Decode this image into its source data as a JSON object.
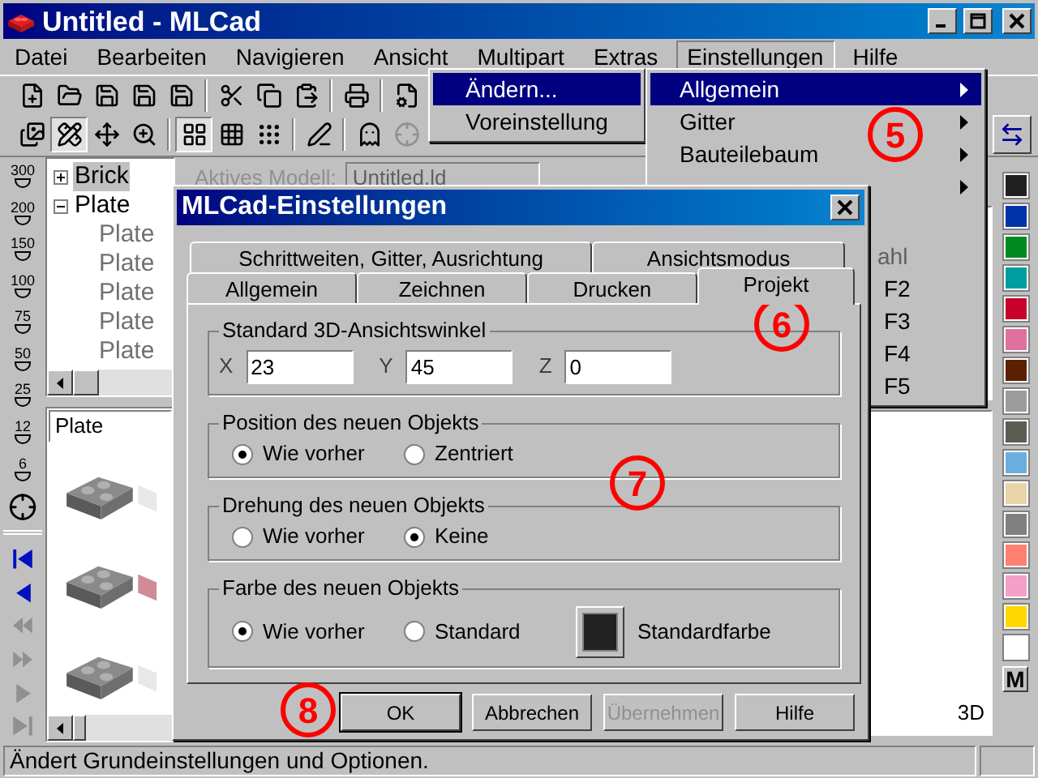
{
  "window": {
    "title": "Untitled - MLCad"
  },
  "menu_bar": [
    {
      "label": "Datei",
      "selected": false
    },
    {
      "label": "Bearbeiten",
      "selected": false
    },
    {
      "label": "Navigieren",
      "selected": false
    },
    {
      "label": "Ansicht",
      "selected": false
    },
    {
      "label": "Multipart",
      "selected": false
    },
    {
      "label": "Extras",
      "selected": false
    },
    {
      "label": "Einstellungen",
      "selected": true
    },
    {
      "label": "Hilfe",
      "selected": false
    }
  ],
  "toolbar_2": [
    {
      "pressed": false,
      "disabled": false
    },
    {
      "pressed": true,
      "disabled": false
    },
    {
      "pressed": false,
      "disabled": false
    },
    {
      "pressed": false,
      "disabled": false
    },
    {
      "pressed": true,
      "disabled": false
    },
    {
      "pressed": false,
      "disabled": false
    },
    {
      "pressed": false,
      "disabled": false
    },
    {
      "pressed": false,
      "disabled": false
    },
    {
      "pressed": false,
      "disabled": false
    },
    {
      "pressed": false,
      "disabled": true
    }
  ],
  "zoom_buttons": [
    "300",
    "200",
    "150",
    "100",
    "75",
    "50",
    "25",
    "12",
    "6"
  ],
  "navigation": [
    {
      "disabled": false
    },
    {
      "disabled": false
    },
    {
      "disabled": true
    },
    {
      "disabled": true
    },
    {
      "disabled": true
    },
    {
      "disabled": true
    }
  ],
  "tree": [
    {
      "label": "Brick",
      "expanded": false,
      "selected": true
    },
    {
      "label": "Plate",
      "expanded": true,
      "selected": false,
      "children": [
        {
          "label": "Plate"
        },
        {
          "label": "Plate"
        },
        {
          "label": "Plate"
        },
        {
          "label": "Plate"
        },
        {
          "label": "Plate"
        }
      ]
    }
  ],
  "active_model": {
    "label": "Aktives Modell:",
    "value": "Untitled.ld"
  },
  "part_filter": {
    "value": "Plate"
  },
  "parts": [
    {
      "kind": "picture"
    },
    {
      "kind": "picture"
    },
    {
      "kind": "picture"
    }
  ],
  "view_label": "3D",
  "palette": [
    {
      "color": "#202020"
    },
    {
      "color": "#0033aa"
    },
    {
      "color": "#008a20"
    },
    {
      "color": "#009ea0"
    },
    {
      "color": "#c8002a"
    },
    {
      "color": "#e070a0"
    },
    {
      "color": "#5a2000"
    },
    {
      "color": "#9c9c9c"
    },
    {
      "color": "#5c5c50"
    },
    {
      "color": "#6aaee0"
    },
    {
      "color": "#e8d4a8"
    },
    {
      "color": "#808080"
    },
    {
      "color": "#ff8070"
    },
    {
      "color": "#f4a0c8"
    },
    {
      "color": "#ffd800"
    },
    {
      "color": "#ffffff"
    }
  ],
  "palette_button": "M",
  "status_bar": "Ändert Grundeinstellungen und Optionen.",
  "settings_menu": [
    {
      "label": "Ändern...",
      "selected": true
    },
    {
      "label": "Voreinstellung",
      "selected": false
    }
  ],
  "submenu": [
    {
      "kind": "item",
      "label": "Allgemein",
      "selected": true
    },
    {
      "kind": "item",
      "label": "Gitter",
      "selected": false
    },
    {
      "kind": "item",
      "label": "Bauteilebaum",
      "selected": false
    },
    {
      "kind": "arrow-only",
      "selected": false
    },
    {
      "kind": "gap"
    },
    {
      "kind": "clipped",
      "label": "ahl",
      "selected": false
    },
    {
      "kind": "shortcut",
      "shortcut": "F2",
      "selected": false
    },
    {
      "kind": "shortcut",
      "shortcut": "F3",
      "selected": false
    },
    {
      "kind": "shortcut",
      "shortcut": "F4",
      "selected": false
    },
    {
      "kind": "shortcut",
      "shortcut": "F5",
      "selected": false
    }
  ],
  "dialog": {
    "title": "MLCad-Einstellungen",
    "tabs_back": [
      {
        "label": "Schrittweiten, Gitter, Ausrichtung",
        "selected": false
      },
      {
        "label": "Ansichtsmodus",
        "selected": false
      }
    ],
    "tabs_front": [
      {
        "label": "Allgemein",
        "selected": false
      },
      {
        "label": "Zeichnen",
        "selected": false
      },
      {
        "label": "Drucken",
        "selected": false
      },
      {
        "label": "Projekt",
        "selected": true
      }
    ],
    "angle_group": {
      "title": "Standard 3D-Ansichtswinkel",
      "fields": [
        {
          "label": "X",
          "value": "23"
        },
        {
          "label": "Y",
          "value": "45"
        },
        {
          "label": "Z",
          "value": "0"
        }
      ]
    },
    "radio_groups": [
      {
        "title": "Position des neuen Objekts",
        "options": [
          {
            "label": "Wie vorher",
            "selected": true
          },
          {
            "label": "Zentriert",
            "selected": false
          }
        ]
      },
      {
        "title": "Drehung des neuen Objekts",
        "options": [
          {
            "label": "Wie vorher",
            "selected": false
          },
          {
            "label": "Keine",
            "selected": true
          }
        ]
      },
      {
        "title": "Farbe des neuen Objekts",
        "options": [
          {
            "label": "Wie vorher",
            "selected": true
          },
          {
            "label": "Standard",
            "selected": false
          }
        ],
        "swatch": {
          "color": "#222222",
          "label": "Standardfarbe"
        }
      }
    ],
    "buttons": [
      {
        "label": "OK",
        "default": true,
        "disabled": false
      },
      {
        "label": "Abbrechen",
        "default": false,
        "disabled": false
      },
      {
        "label": "Übernehmen",
        "default": false,
        "disabled": true
      },
      {
        "label": "Hilfe",
        "default": false,
        "disabled": false
      }
    ]
  },
  "callouts": [
    "5",
    "6",
    "7",
    "8"
  ]
}
